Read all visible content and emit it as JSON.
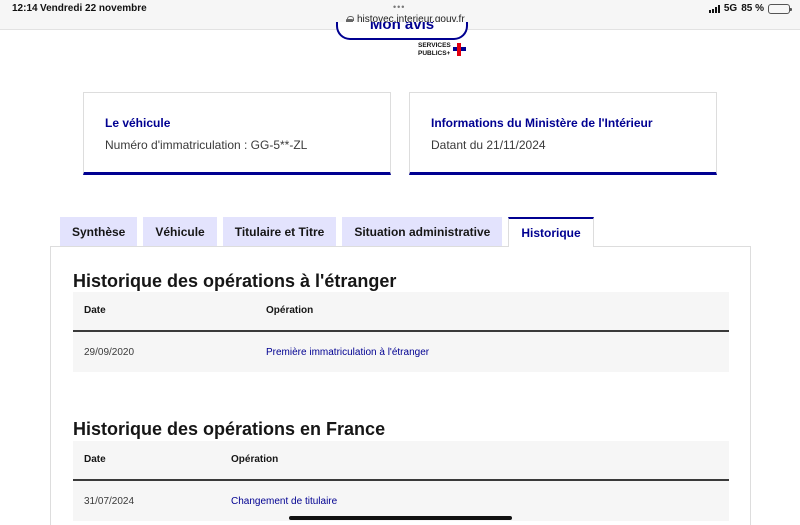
{
  "statusbar": {
    "time": "12:14",
    "date": "Vendredi 22 novembre",
    "dots": "•••",
    "url": "histovec.interieur.gouv.fr",
    "network": "5G",
    "battery": "85 %",
    "battery_level": 0.85
  },
  "header": {
    "button_label": "Mon avis",
    "logo_line1": "SERVICES",
    "logo_line2": "PUBLICS+"
  },
  "cards": {
    "vehicule": {
      "title": "Le véhicule",
      "text": "Numéro d'immatriculation : GG-5**-ZL"
    },
    "ministere": {
      "title": "Informations du Ministère de l'Intérieur",
      "text": "Datant du 21/11/2024"
    }
  },
  "tabs": [
    {
      "label": "Synthèse"
    },
    {
      "label": "Véhicule"
    },
    {
      "label": "Titulaire et Titre"
    },
    {
      "label": "Situation administrative"
    },
    {
      "label": "Historique",
      "active": true
    }
  ],
  "history_abroad": {
    "title": "Historique des opérations à l'étranger",
    "columns": [
      "Date",
      "Opération"
    ],
    "rows": [
      {
        "date": "29/09/2020",
        "operation": "Première immatriculation à l'étranger"
      }
    ]
  },
  "history_france": {
    "title": "Historique des opérations en France",
    "columns": [
      "Date",
      "Opération"
    ],
    "rows": [
      {
        "date": "31/07/2024",
        "operation": "Changement de titulaire"
      }
    ]
  },
  "colors": {
    "primary": "#000091",
    "tab_bg": "#e3e3fd",
    "table_bg": "#f6f6f6",
    "accent_red": "#e1000f"
  }
}
